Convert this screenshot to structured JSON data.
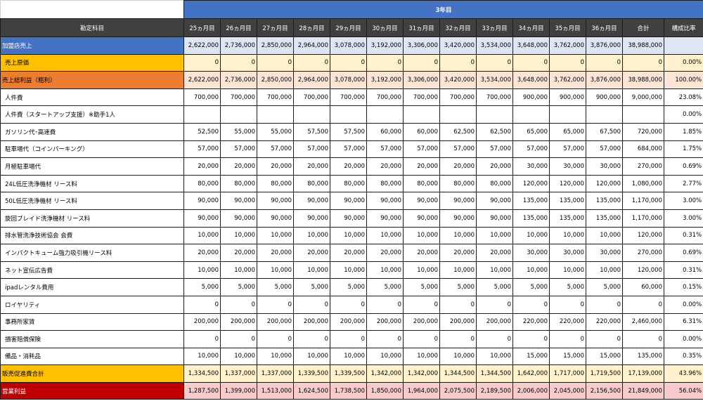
{
  "year_label": "3年目",
  "header": {
    "account": "勘定科目",
    "months": [
      "25ヵ月目",
      "26ヵ月目",
      "27ヵ月目",
      "28ヵ月目",
      "29ヵ月目",
      "30ヵ月目",
      "31ヵ月目",
      "32ヵ月目",
      "33ヵ月目",
      "34ヵ月目",
      "35ヵ月目",
      "36ヵ月目"
    ],
    "total": "合計",
    "ratio": "構成比率"
  },
  "rows": [
    {
      "style": "sales",
      "label": "加盟店売上",
      "values": [
        "2,622,000",
        "2,736,000",
        "2,850,000",
        "2,964,000",
        "3,078,000",
        "3,192,000",
        "3,306,000",
        "3,420,000",
        "3,534,000",
        "3,648,000",
        "3,762,000",
        "3,876,000"
      ],
      "total": "38,988,000",
      "ratio": ""
    },
    {
      "style": "cogs",
      "label": "売上原価",
      "values": [
        "0",
        "0",
        "0",
        "0",
        "0",
        "0",
        "0",
        "0",
        "0",
        "0",
        "0",
        "0"
      ],
      "total": "0",
      "ratio": "0.00%"
    },
    {
      "style": "gross",
      "label": "売上総利益（粗利）",
      "values": [
        "2,622,000",
        "2,736,000",
        "2,850,000",
        "2,964,000",
        "3,078,000",
        "3,192,000",
        "3,306,000",
        "3,420,000",
        "3,534,000",
        "3,648,000",
        "3,762,000",
        "3,876,000"
      ],
      "total": "38,988,000",
      "ratio": "100.00%"
    },
    {
      "style": "plain",
      "label": "人件費",
      "values": [
        "700,000",
        "700,000",
        "700,000",
        "700,000",
        "700,000",
        "700,000",
        "700,000",
        "700,000",
        "700,000",
        "900,000",
        "900,000",
        "900,000"
      ],
      "total": "9,000,000",
      "ratio": "23.08%"
    },
    {
      "style": "plain",
      "label": "人件費（スタートアップ支援）※助手1人",
      "values": [
        "",
        "",
        "",
        "",
        "",
        "",
        "",
        "",
        "",
        "",
        "",
        ""
      ],
      "total": "",
      "ratio": "0.00%"
    },
    {
      "style": "plain",
      "label": "ガソリン代･高速費",
      "values": [
        "52,500",
        "55,000",
        "55,000",
        "57,500",
        "57,500",
        "60,000",
        "60,000",
        "62,500",
        "62,500",
        "65,000",
        "65,000",
        "67,500"
      ],
      "total": "720,000",
      "ratio": "1.85%"
    },
    {
      "style": "plain",
      "label": "駐車場代（コインパーキング）",
      "values": [
        "57,000",
        "57,000",
        "57,000",
        "57,000",
        "57,000",
        "57,000",
        "57,000",
        "57,000",
        "57,000",
        "57,000",
        "57,000",
        "57,000"
      ],
      "total": "684,000",
      "ratio": "1.75%"
    },
    {
      "style": "plain",
      "label": "月極駐車場代",
      "values": [
        "20,000",
        "20,000",
        "20,000",
        "20,000",
        "20,000",
        "20,000",
        "20,000",
        "20,000",
        "20,000",
        "30,000",
        "30,000",
        "30,000"
      ],
      "total": "270,000",
      "ratio": "0.69%"
    },
    {
      "style": "plain",
      "label": "24L低圧洗浄機材 リース料",
      "values": [
        "80,000",
        "80,000",
        "80,000",
        "80,000",
        "80,000",
        "80,000",
        "80,000",
        "80,000",
        "80,000",
        "120,000",
        "120,000",
        "120,000"
      ],
      "total": "1,080,000",
      "ratio": "2.77%"
    },
    {
      "style": "plain",
      "label": "50L低圧洗浄機材 リース料",
      "values": [
        "90,000",
        "90,000",
        "90,000",
        "90,000",
        "90,000",
        "90,000",
        "90,000",
        "90,000",
        "90,000",
        "135,000",
        "135,000",
        "135,000"
      ],
      "total": "1,170,000",
      "ratio": "3.00%"
    },
    {
      "style": "plain",
      "label": "旋回ブレイド洗浄機材 リース料",
      "values": [
        "90,000",
        "90,000",
        "90,000",
        "90,000",
        "90,000",
        "90,000",
        "90,000",
        "90,000",
        "90,000",
        "135,000",
        "135,000",
        "135,000"
      ],
      "total": "1,170,000",
      "ratio": "3.00%"
    },
    {
      "style": "plain",
      "label": "排水管洗浄技術協会 会費",
      "values": [
        "10,000",
        "10,000",
        "10,000",
        "10,000",
        "10,000",
        "10,000",
        "10,000",
        "10,000",
        "10,000",
        "10,000",
        "10,000",
        "10,000"
      ],
      "total": "120,000",
      "ratio": "0.31%"
    },
    {
      "style": "plain",
      "label": "インパクトキューム強力吸引機リース料",
      "values": [
        "20,000",
        "20,000",
        "20,000",
        "20,000",
        "20,000",
        "20,000",
        "20,000",
        "20,000",
        "20,000",
        "30,000",
        "30,000",
        "30,000"
      ],
      "total": "270,000",
      "ratio": "0.69%"
    },
    {
      "style": "plain",
      "label": "ネット宣伝広告費",
      "values": [
        "10,000",
        "10,000",
        "10,000",
        "10,000",
        "10,000",
        "10,000",
        "10,000",
        "10,000",
        "10,000",
        "10,000",
        "10,000",
        "10,000"
      ],
      "total": "120,000",
      "ratio": "0.31%"
    },
    {
      "style": "plain",
      "label": "ipadレンタル費用",
      "values": [
        "5,000",
        "5,000",
        "5,000",
        "5,000",
        "5,000",
        "5,000",
        "5,000",
        "5,000",
        "5,000",
        "5,000",
        "5,000",
        "5,000"
      ],
      "total": "60,000",
      "ratio": "0.15%"
    },
    {
      "style": "plain",
      "label": "ロイヤリティ",
      "values": [
        "0",
        "0",
        "0",
        "0",
        "0",
        "0",
        "0",
        "0",
        "0",
        "0",
        "0",
        "0"
      ],
      "total": "0",
      "ratio": "0.00%"
    },
    {
      "style": "plain",
      "label": "事務所家賃",
      "values": [
        "200,000",
        "200,000",
        "200,000",
        "200,000",
        "200,000",
        "200,000",
        "200,000",
        "200,000",
        "200,000",
        "220,000",
        "220,000",
        "220,000"
      ],
      "total": "2,460,000",
      "ratio": "6.31%"
    },
    {
      "style": "plain",
      "label": "損害賠償保険",
      "values": [
        "0",
        "0",
        "0",
        "0",
        "0",
        "0",
        "0",
        "0",
        "0",
        "0",
        "0",
        "0"
      ],
      "total": "0",
      "ratio": "0.00%"
    },
    {
      "style": "plain",
      "label": "備品・消耗品",
      "values": [
        "10,000",
        "10,000",
        "10,000",
        "10,000",
        "10,000",
        "10,000",
        "10,000",
        "10,000",
        "10,000",
        "15,000",
        "15,000",
        "15,000"
      ],
      "total": "135,000",
      "ratio": "0.35%"
    },
    {
      "style": "prom",
      "label": "販売促進費合計",
      "values": [
        "1,334,500",
        "1,337,000",
        "1,337,000",
        "1,339,500",
        "1,339,500",
        "1,342,000",
        "1,342,000",
        "1,344,500",
        "1,344,500",
        "1,642,000",
        "1,717,000",
        "1,719,500"
      ],
      "total": "17,139,000",
      "ratio": "43.96%"
    },
    {
      "style": "op",
      "label": "営業利益",
      "values": [
        "1,287,500",
        "1,399,000",
        "1,513,000",
        "1,624,500",
        "1,738,500",
        "1,850,000",
        "1,964,000",
        "2,075,500",
        "2,189,500",
        "2,006,000",
        "2,045,000",
        "2,156,500"
      ],
      "total": "21,849,000",
      "ratio": "56.04%"
    }
  ]
}
